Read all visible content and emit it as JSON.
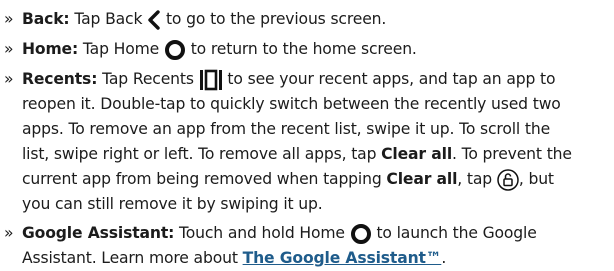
{
  "bullet": "»",
  "items": [
    {
      "term": "Back:",
      "lines": [
        {
          "pre": " Tap Back ",
          "post": " to go to the previous screen."
        }
      ]
    },
    {
      "term": "Home:",
      "lines": [
        {
          "pre": " Tap Home ",
          "post": " to return to the home screen."
        }
      ]
    },
    {
      "term": "Recents:",
      "lines": [
        {
          "pre": " Tap Recents ",
          "post": " to see your recent apps, and tap an app to"
        },
        {
          "text": "reopen it. Double-tap to quickly switch between the recently used two"
        },
        {
          "text": "apps. To remove an app from the recent list, swipe it up. To scroll the"
        },
        {
          "pre": "list, swipe right or left. To remove all apps, tap ",
          "bold": "Clear all",
          "post": ". To prevent the"
        },
        {
          "pre": "current app from being removed when tapping ",
          "bold": "Clear all",
          "mid": ", tap ",
          "post": ", but"
        },
        {
          "text": "you can still remove it by swiping it up."
        }
      ]
    },
    {
      "term": "Google Assistant:",
      "lines": [
        {
          "pre": " Touch and hold Home ",
          "post": " to launch the Google"
        },
        {
          "pre": "Assistant. Learn more about ",
          "link": "The Google Assistant™",
          "post": "."
        }
      ]
    }
  ],
  "colors": {
    "text": "#1c1c1c",
    "link": "#1f5c8b"
  },
  "icons": [
    "back-chevron-icon",
    "home-circle-icon",
    "recents-icon",
    "lock-icon",
    "home-circle-icon"
  ]
}
